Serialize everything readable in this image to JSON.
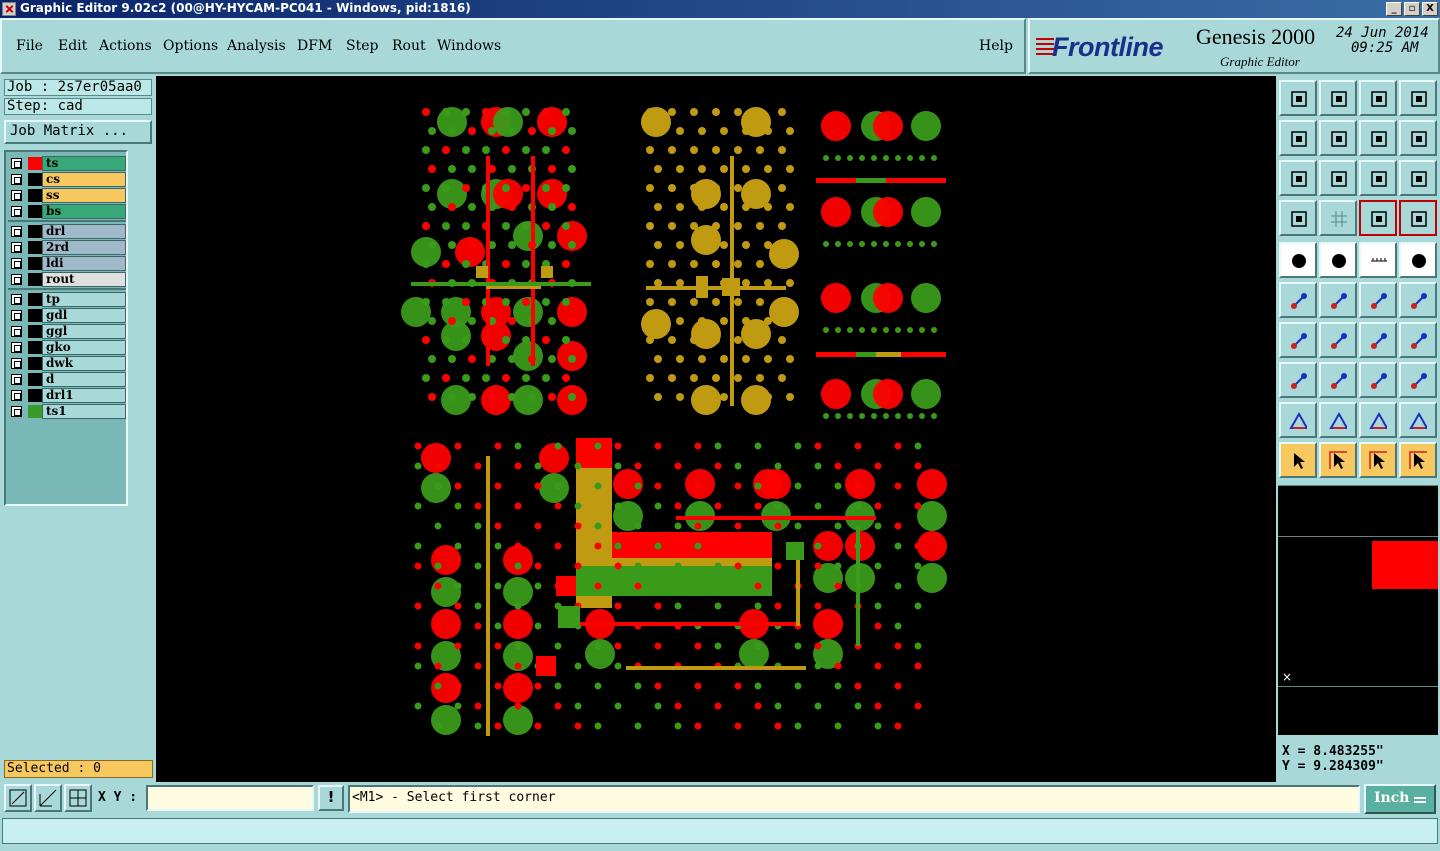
{
  "window": {
    "title": "Graphic Editor 9.02c2 (00@HY-HYCAM-PC041 - Windows, pid:1816)",
    "buttons": [
      "_",
      "▫",
      "X"
    ]
  },
  "menu": [
    "File",
    "Edit",
    "Actions",
    "Options",
    "Analysis",
    "DFM",
    "Step",
    "Rout",
    "Windows",
    "Help"
  ],
  "brand": {
    "logo": "Frontline",
    "product": "Genesis 2000",
    "subtitle": "Graphic Editor",
    "date": "24 Jun 2014",
    "time": "09:25 AM"
  },
  "job": {
    "job_line": "Job : 2s7er05aa0",
    "step_line": "Step: cad",
    "matrix_button": "Job Matrix ..."
  },
  "layers": [
    {
      "name": "ts",
      "color": "#38a878",
      "swatch": "#ff0000"
    },
    {
      "name": "cs",
      "color": "#f8c860",
      "swatch": "#000000"
    },
    {
      "name": "ss",
      "color": "#f8c860",
      "swatch": "#000000"
    },
    {
      "name": "bs",
      "color": "#38a878",
      "swatch": "#000000"
    },
    {
      "name": "drl",
      "color": "#a0b8c8",
      "swatch": "#000000"
    },
    {
      "name": "2rd",
      "color": "#a0b8c8",
      "swatch": "#000000"
    },
    {
      "name": "ldi",
      "color": "#a0b8c8",
      "swatch": "#000000"
    },
    {
      "name": "rout",
      "color": "#e0e0e0",
      "swatch": "#000000"
    },
    {
      "name": "tp",
      "color": "#a8d8d8",
      "swatch": "#000000"
    },
    {
      "name": "gdl",
      "color": "#a8d8d8",
      "swatch": "#000000"
    },
    {
      "name": "ggl",
      "color": "#a8d8d8",
      "swatch": "#000000"
    },
    {
      "name": "gko",
      "color": "#a8d8d8",
      "swatch": "#000000"
    },
    {
      "name": "dwk",
      "color": "#a8d8d8",
      "swatch": "#000000"
    },
    {
      "name": "d",
      "color": "#a8d8d8",
      "swatch": "#000000"
    },
    {
      "name": "drl1",
      "color": "#a8d8d8",
      "swatch": "#000000"
    },
    {
      "name": "ts1",
      "color": "#a8d8d8",
      "swatch": "#3a9a2a"
    }
  ],
  "selected": "Selected : 0",
  "coords": {
    "x": "X = 8.483255\"",
    "y": "Y = 9.284309\""
  },
  "bottom": {
    "xy_label": "X Y :",
    "xy_value": "",
    "excl": "!",
    "prompt": "<M1> - Select first corner",
    "unit": "Inch"
  },
  "colors": {
    "red": "#ff0000",
    "green": "#3a9a1a",
    "olive": "#c09a10",
    "background": "#000000"
  }
}
